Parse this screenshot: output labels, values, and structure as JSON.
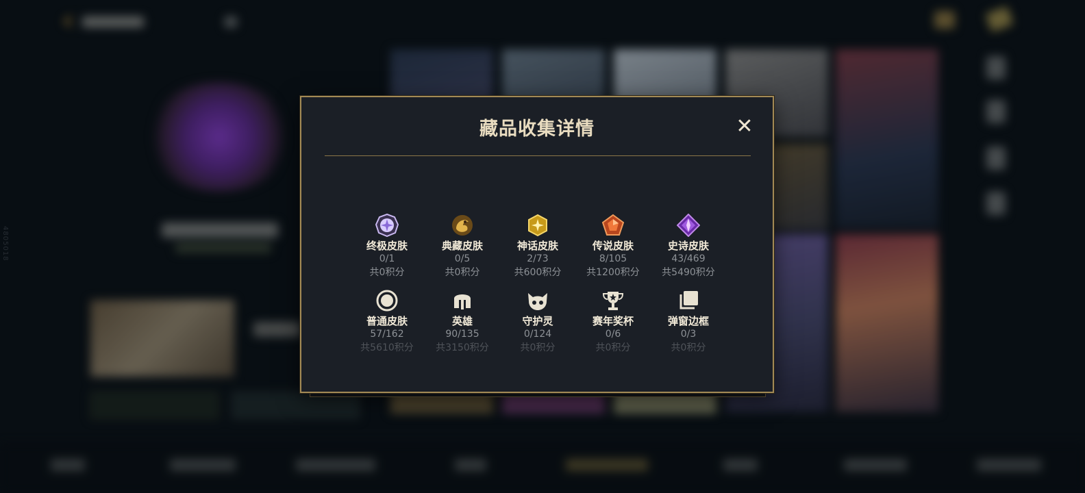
{
  "side_label": "4805018",
  "modal": {
    "title": "藏品收集详情",
    "close_label": "✕"
  },
  "collections": [
    [
      {
        "name": "终极皮肤",
        "count": "0/1",
        "points": "共0积分",
        "icon": "ultimate-skin-icon"
      },
      {
        "name": "典藏皮肤",
        "count": "0/5",
        "points": "共0积分",
        "icon": "treasure-skin-icon"
      },
      {
        "name": "神话皮肤",
        "count": "2/73",
        "points": "共600积分",
        "icon": "mythic-skin-icon"
      },
      {
        "name": "传说皮肤",
        "count": "8/105",
        "points": "共1200积分",
        "icon": "legendary-skin-icon"
      },
      {
        "name": "史诗皮肤",
        "count": "43/469",
        "points": "共5490积分",
        "icon": "epic-skin-icon"
      }
    ],
    [
      {
        "name": "普通皮肤",
        "count": "57/162",
        "points": "共5610积分",
        "icon": "normal-skin-icon"
      },
      {
        "name": "英雄",
        "count": "90/135",
        "points": "共3150积分",
        "icon": "hero-helmet-icon"
      },
      {
        "name": "守护灵",
        "count": "0/124",
        "points": "共0积分",
        "icon": "guardian-spirit-icon"
      },
      {
        "name": "赛年奖杯",
        "count": "0/6",
        "points": "共0积分",
        "icon": "season-trophy-icon"
      },
      {
        "name": "弹窗边框",
        "count": "0/3",
        "points": "共0积分",
        "icon": "popup-frame-icon"
      }
    ]
  ],
  "colors": {
    "accent_gold": "#a38a55",
    "modal_bg": "#1b1f26",
    "title_text": "#e9dcc0"
  }
}
